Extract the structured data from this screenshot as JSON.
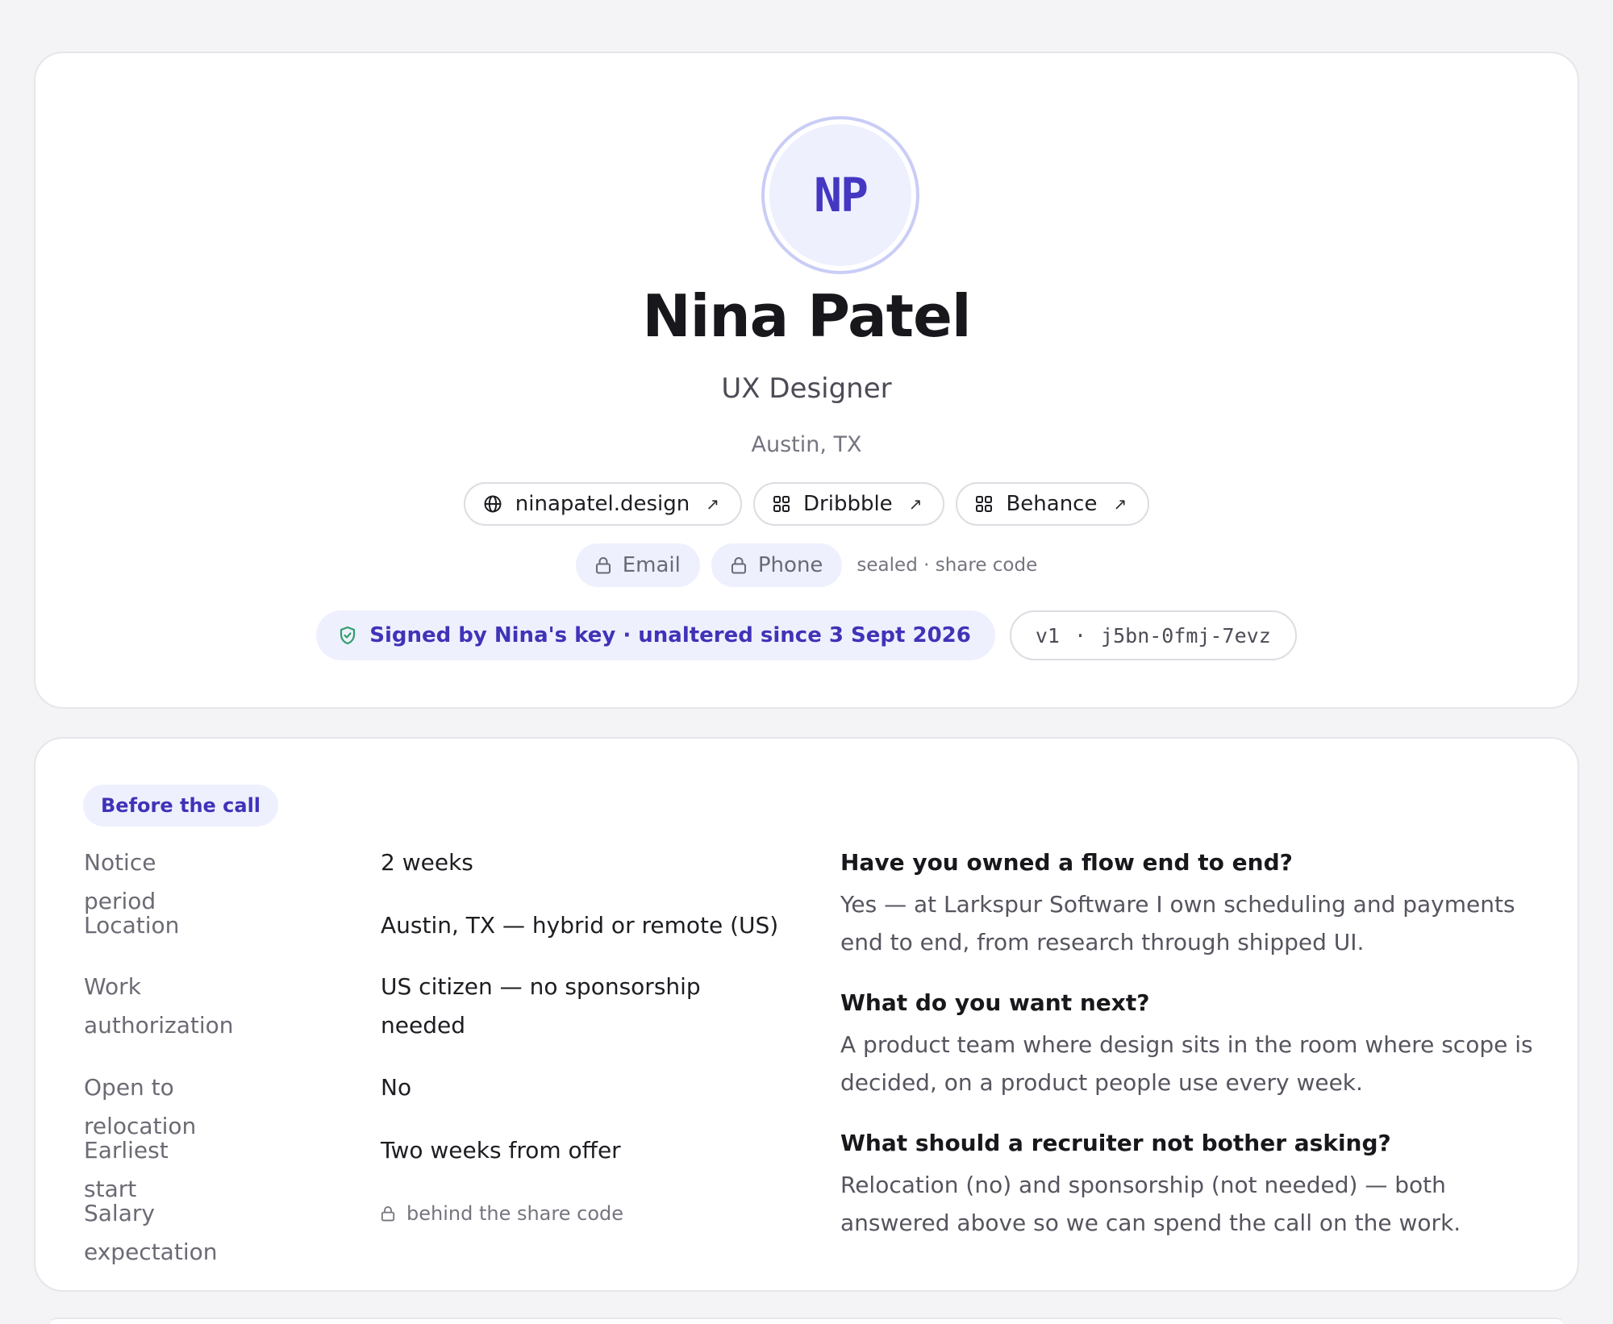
{
  "profile": {
    "initials": "NP",
    "name": "Nina Patel",
    "role": "UX Designer",
    "location": "Austin, TX",
    "links": [
      {
        "label": "ninapatel.design",
        "icon": "globe-icon"
      },
      {
        "label": "Dribbble",
        "icon": "grid-icon"
      },
      {
        "label": "Behance",
        "icon": "grid-icon"
      }
    ],
    "link_arrow": "↗",
    "contact": {
      "email_label": "Email",
      "phone_label": "Phone",
      "note": "sealed · share code"
    },
    "signature": {
      "text": "Signed by Nina's key · unaltered since 3 Sept 2026",
      "version": "v1",
      "separator": "·",
      "code": "j5bn-0fmj-7evz"
    }
  },
  "details": {
    "badge": "Before the call",
    "facts": [
      {
        "label": "Notice period",
        "value": "2 weeks"
      },
      {
        "label": "Location",
        "value": "Austin, TX — hybrid or remote (US)"
      },
      {
        "label": "Work authorization",
        "value": "US citizen — no sponsorship needed"
      },
      {
        "label": "Open to relocation",
        "value": "No"
      },
      {
        "label": "Earliest start",
        "value": "Two weeks from offer"
      },
      {
        "label": "Salary expectation",
        "value": "behind the share code"
      }
    ],
    "qa": [
      {
        "q": "Have you owned a flow end to end?",
        "a": "Yes — at Larkspur Software I own scheduling and payments end to end, from research through shipped UI."
      },
      {
        "q": "What do you want next?",
        "a": "A product team where design sits in the room where scope is decided, on a product people use every week."
      },
      {
        "q": "What should a recruiter not bother asking?",
        "a": "Relocation (no) and sponsorship (not needed) — both answered above so we can spend the call on the work."
      }
    ]
  },
  "colors": {
    "accent": "#4033b8",
    "accent_soft": "#eef0fe",
    "shield": "#2e9e6a"
  }
}
